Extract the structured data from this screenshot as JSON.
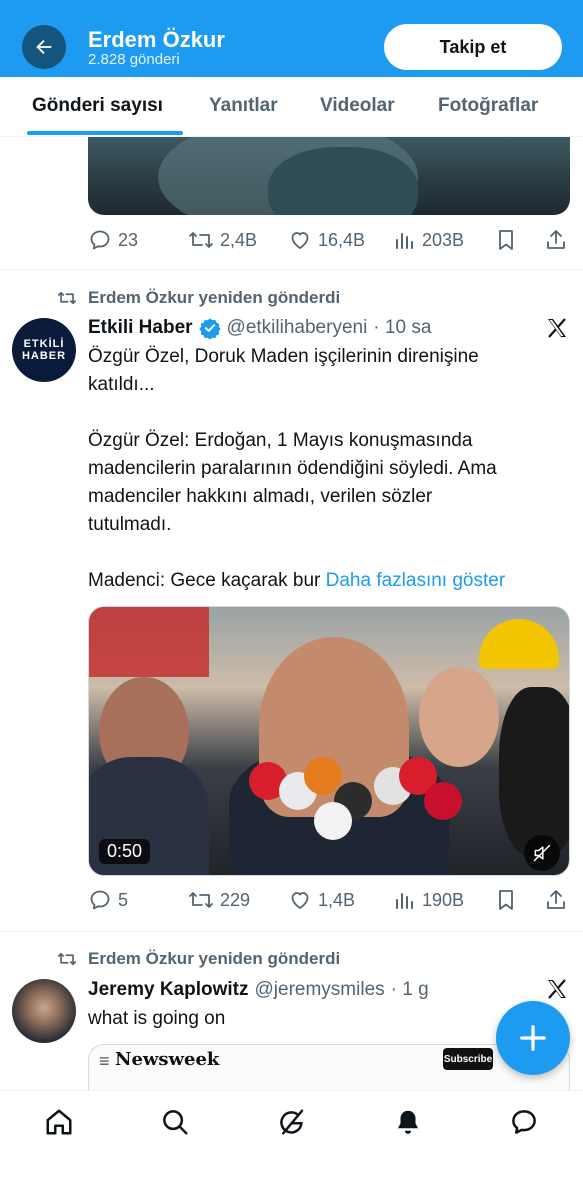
{
  "header": {
    "name": "Erdem Özkur",
    "post_count": "2.828 gönderi",
    "follow_label": "Takip et",
    "accent": "#1d9bf0"
  },
  "tabs": [
    {
      "label": "Gönderi sayısı",
      "active": true
    },
    {
      "label": "Yanıtlar",
      "active": false
    },
    {
      "label": "Videolar",
      "active": false
    },
    {
      "label": "Fotoğraflar",
      "active": false
    }
  ],
  "post1": {
    "replies": "23",
    "reposts": "2,4B",
    "likes": "16,4B",
    "views": "203B"
  },
  "post2": {
    "repost_label": "Erdem Özkur yeniden gönderdi",
    "author": "Etkili Haber",
    "verified": true,
    "handle": "@etkilihaberyeni",
    "time": "· 10 sa",
    "avatar_text_1": "ETKİLİ",
    "avatar_text_2": "HABER",
    "text_lines": [
      "Özgür Özel, Doruk Maden işçilerinin direnişine",
      "katıldı...",
      "",
      "Özgür Özel: Erdoğan, 1 Mayıs konuşmasında",
      "madencilerin paralarının ödendiğini söyledi. Ama",
      "madenciler hakkını almadı, verilen sözler",
      "tutulmadı.",
      ""
    ],
    "last_line": "Madenci: Gece kaçarak bur",
    "show_more": "Daha fazlasını göster",
    "video_duration": "0:50",
    "replies": "5",
    "reposts": "229",
    "likes": "1,4B",
    "views": "190B"
  },
  "post3": {
    "repost_label": "Erdem Özkur yeniden gönderdi",
    "author": "Jeremy Kaplowitz",
    "handle": "@jeremysmiles",
    "time": "· 1 g",
    "text": "what is going on",
    "card_brand": "Newsweek",
    "card_subscribe": "Subscribe"
  },
  "nav": {
    "items": [
      "home-icon",
      "search-icon",
      "grok-icon",
      "notifications-icon",
      "messages-icon"
    ]
  },
  "fab": {
    "icon": "plus-icon"
  }
}
